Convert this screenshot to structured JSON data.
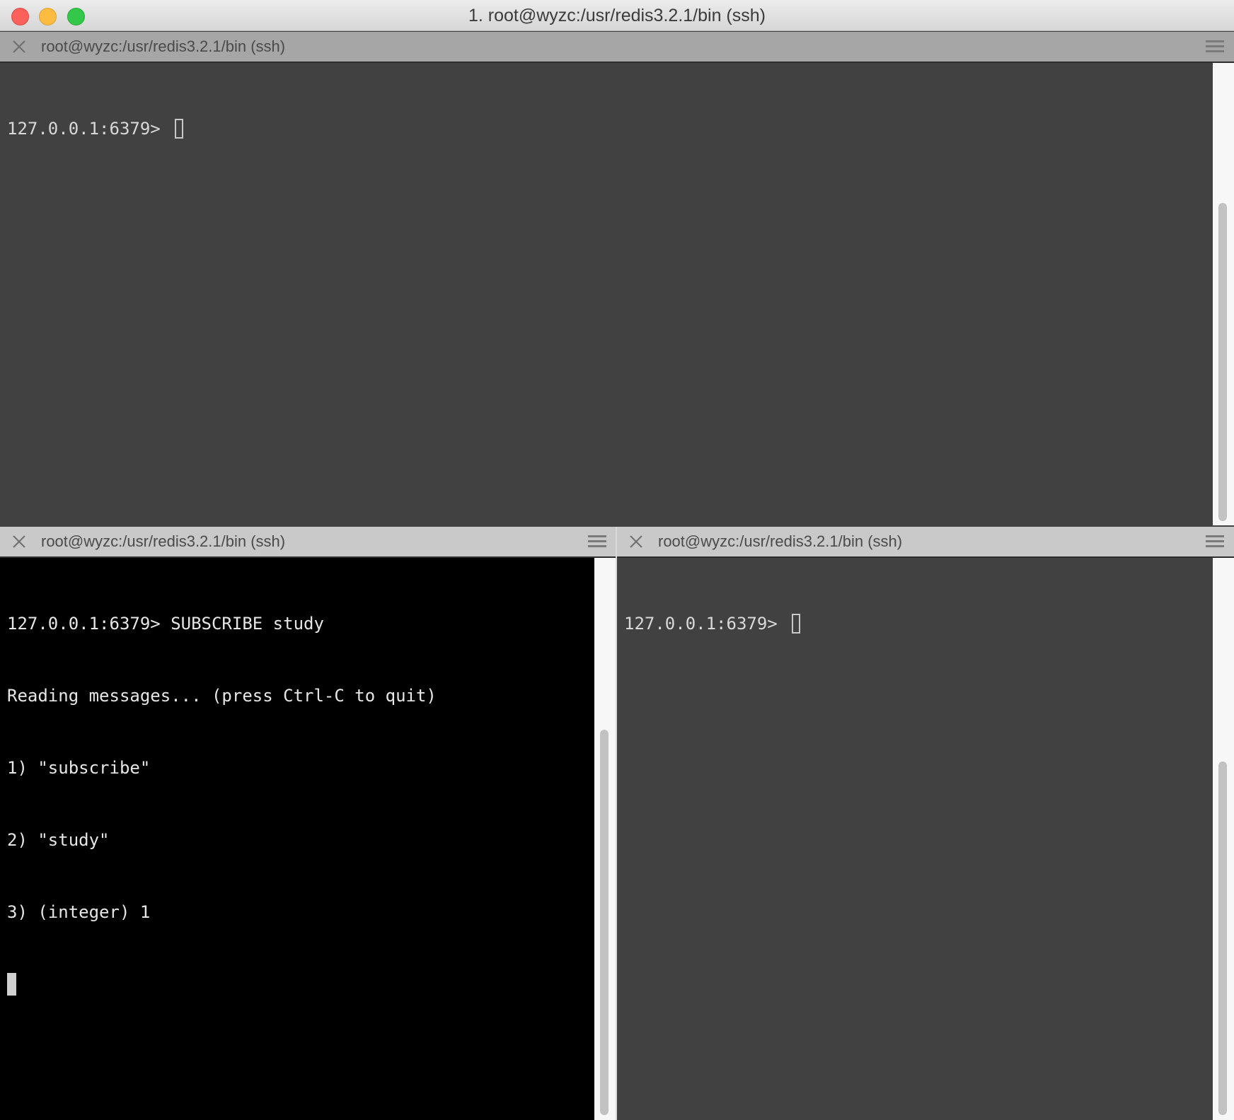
{
  "window": {
    "title": "1. root@wyzc:/usr/redis3.2.1/bin (ssh)"
  },
  "panes": {
    "top": {
      "header_title": "root@wyzc:/usr/redis3.2.1/bin (ssh)",
      "prompt": "127.0.0.1:6379> ",
      "scroll_position": 0.3
    },
    "bottom_left": {
      "header_title": "root@wyzc:/usr/redis3.2.1/bin (ssh)",
      "lines": [
        "127.0.0.1:6379> SUBSCRIBE study",
        "Reading messages... (press Ctrl-C to quit)",
        "1) \"subscribe\"",
        "2) \"study\"",
        "3) (integer) 1"
      ]
    },
    "bottom_right": {
      "header_title": "root@wyzc:/usr/redis3.2.1/bin (ssh)",
      "prompt": "127.0.0.1:6379> "
    }
  },
  "icons": {
    "close": "close-icon",
    "menu": "hamburger-menu-icon"
  },
  "colors": {
    "traffic_close": "#fc605b",
    "traffic_minimize": "#fdbc40",
    "traffic_zoom": "#34c84a",
    "terminal_bg": "#414141",
    "subscriber_bg": "#000000"
  }
}
